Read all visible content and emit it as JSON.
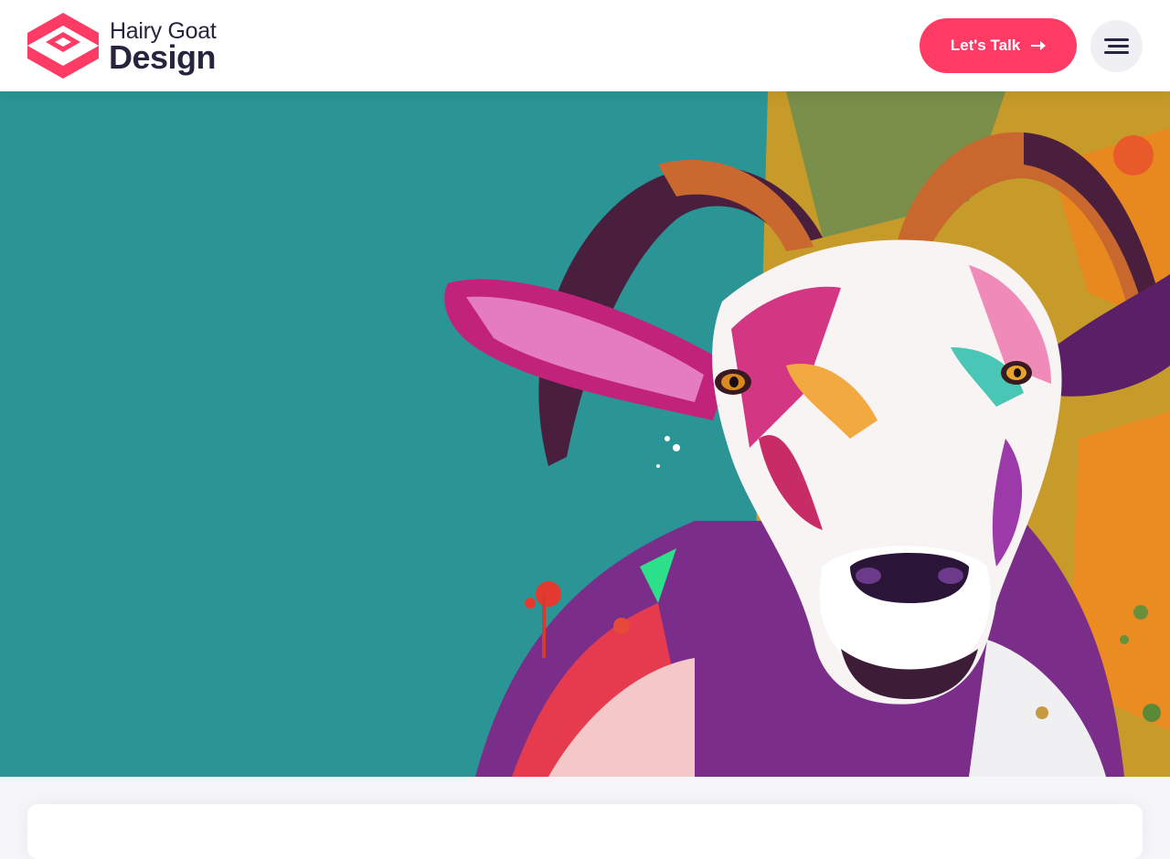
{
  "header": {
    "logo": {
      "line1": "Hairy Goat",
      "line2": "Design",
      "icon": "logo-mark-icon"
    },
    "cta": {
      "label": "Let's Talk",
      "icon": "arrow-right-icon"
    },
    "menu": {
      "icon": "hamburger-menu-icon"
    }
  },
  "hero": {
    "image": "goat-illustration",
    "background_color": "#2b9596"
  },
  "colors": {
    "accent": "#fd3b64",
    "text_dark": "#25253f"
  }
}
